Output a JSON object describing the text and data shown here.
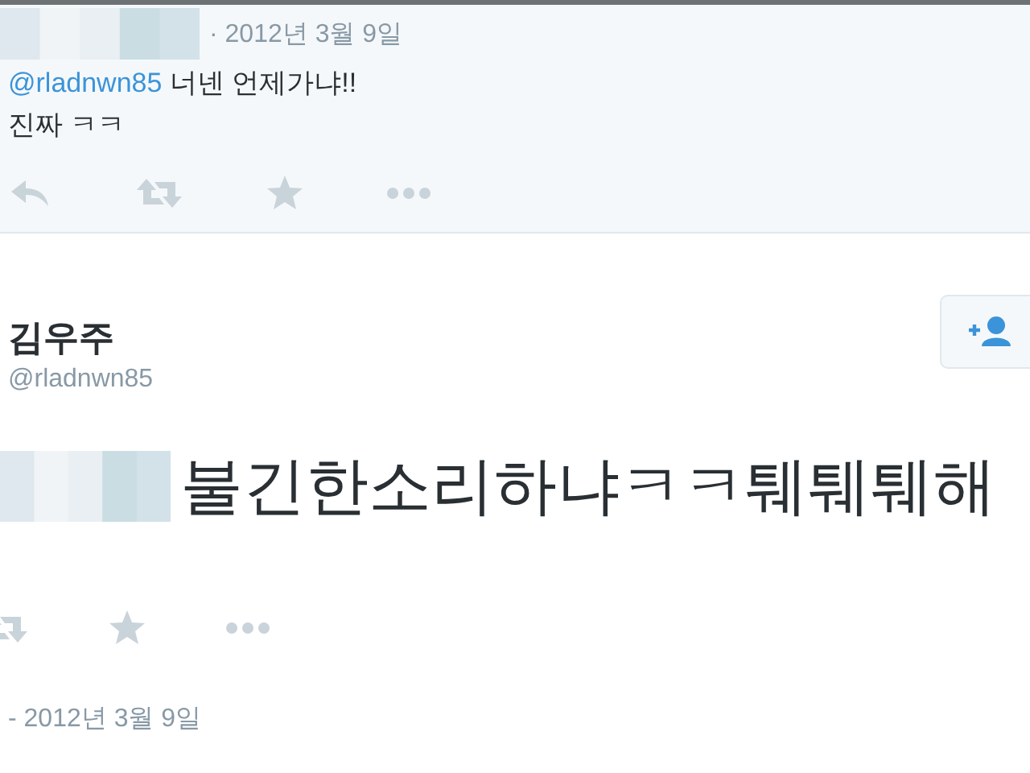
{
  "reply_tweet": {
    "date": "· 2012년 3월 9일",
    "mention": "@rladnwn85",
    "text": "너넨 언제가냐!!",
    "text_line_2": "진짜 ㅋㅋ"
  },
  "main_tweet": {
    "name": "김우주",
    "handle": "@rladnwn85",
    "text": "불긴한소리하냐ㅋㅋ퉤퉤퉤해",
    "timestamp": "- 2012년 3월 9일"
  }
}
